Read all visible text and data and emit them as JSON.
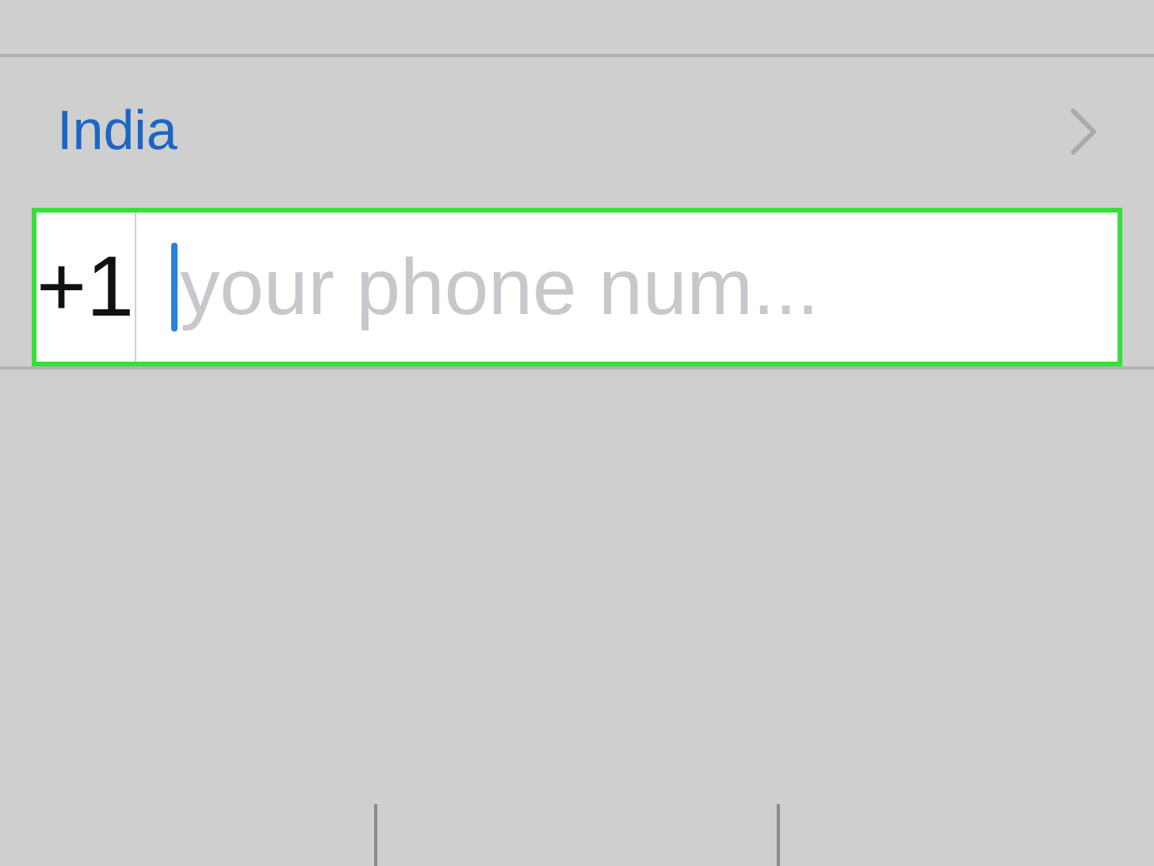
{
  "country": {
    "name": "India"
  },
  "phone": {
    "code": "+1",
    "placeholder": "your phone num...",
    "focused": true,
    "highlighted": true
  },
  "keypad": {
    "keys_cut_off": true
  }
}
